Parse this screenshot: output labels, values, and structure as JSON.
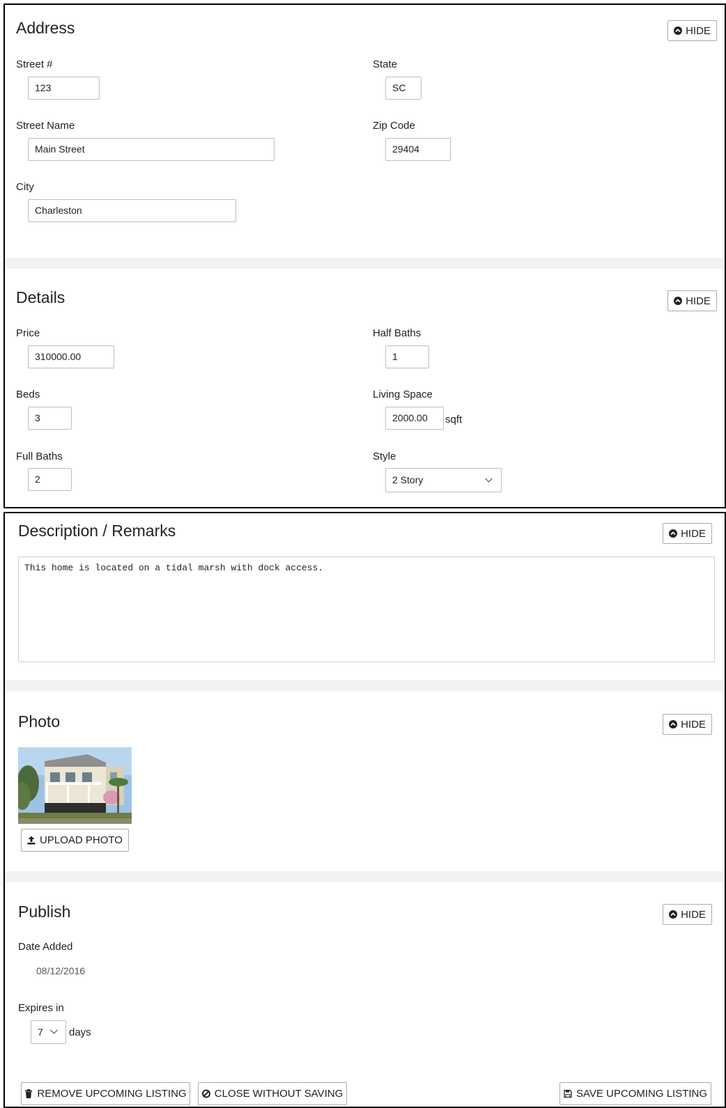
{
  "address": {
    "title": "Address",
    "hide_label": "HIDE",
    "street_number": {
      "label": "Street #",
      "value": "123"
    },
    "state": {
      "label": "State",
      "value": "SC"
    },
    "street_name": {
      "label": "Street Name",
      "value": "Main Street"
    },
    "zip_code": {
      "label": "Zip Code",
      "value": "29404"
    },
    "city": {
      "label": "City",
      "value": "Charleston"
    }
  },
  "details": {
    "title": "Details",
    "hide_label": "HIDE",
    "price": {
      "label": "Price",
      "value": "310000.00"
    },
    "half_baths": {
      "label": "Half Baths",
      "value": "1"
    },
    "beds": {
      "label": "Beds",
      "value": "3"
    },
    "living_space": {
      "label": "Living Space",
      "value": "2000.00",
      "unit": "sqft"
    },
    "full_baths": {
      "label": "Full Baths",
      "value": "2"
    },
    "style": {
      "label": "Style",
      "value": "2 Story"
    }
  },
  "description": {
    "title": "Description / Remarks",
    "hide_label": "HIDE",
    "text": "This home is located on a tidal marsh with dock access."
  },
  "photo": {
    "title": "Photo",
    "hide_label": "HIDE",
    "upload_label": "UPLOAD PHOTO"
  },
  "publish": {
    "title": "Publish",
    "hide_label": "HIDE",
    "date_added": {
      "label": "Date Added",
      "value": "08/12/2016"
    },
    "expires": {
      "label": "Expires in",
      "value": "7",
      "unit": "days"
    },
    "remove_label": "REMOVE UPCOMING LISTING",
    "close_label": "CLOSE WITHOUT SAVING",
    "save_label": "SAVE UPCOMING LISTING"
  },
  "icons": {
    "hide": "chevron-up-circle-icon",
    "upload": "upload-icon",
    "remove": "trash-icon",
    "close": "ban-icon",
    "save": "floppy-disk-icon",
    "select": "chevron-down-icon"
  }
}
